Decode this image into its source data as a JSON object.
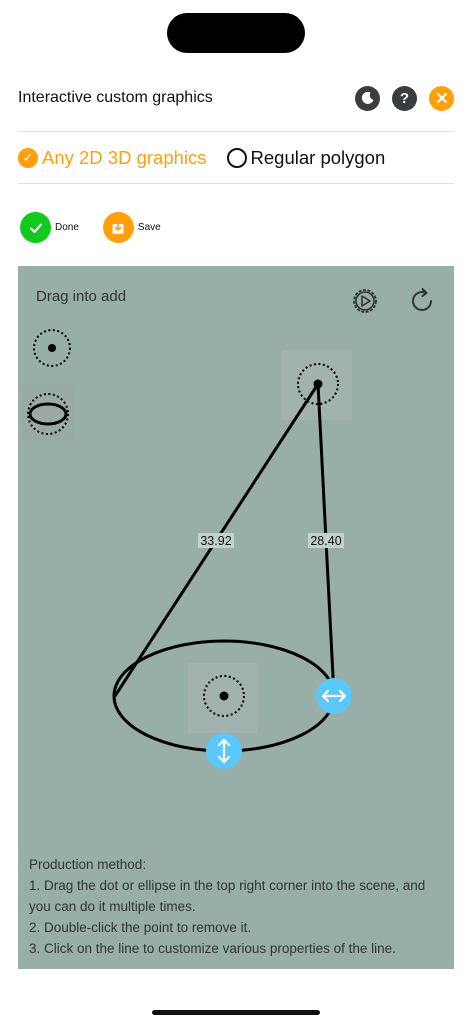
{
  "header": {
    "title": "Interactive custom graphics"
  },
  "tabs": [
    {
      "label": "Any 2D 3D graphics",
      "selected": true
    },
    {
      "label": "Regular polygon",
      "selected": false
    }
  ],
  "actions": {
    "done_label": "Done",
    "save_label": "Save"
  },
  "canvas": {
    "hint": "Drag into add",
    "lengths": {
      "left": "33.92",
      "right": "28.40"
    }
  },
  "method": {
    "heading": "Production method:",
    "steps": [
      "1. Drag the dot or ellipse in the top right corner into the scene, and you can do it multiple times.",
      "2. Double-click the point to remove it.",
      "3. Click on the line to customize various properties of the line."
    ]
  },
  "colors": {
    "accent": "#ff9f0a",
    "done": "#12c91e",
    "canvas_bg": "#97aea9",
    "handle": "#5ac8fa"
  },
  "icons": [
    "moon-icon",
    "help-icon",
    "close-icon",
    "check-icon",
    "save-icon",
    "settings-icon",
    "refresh-icon",
    "point-tool-icon",
    "ellipse-tool-icon",
    "vertical-arrows-icon",
    "horizontal-arrows-icon"
  ]
}
